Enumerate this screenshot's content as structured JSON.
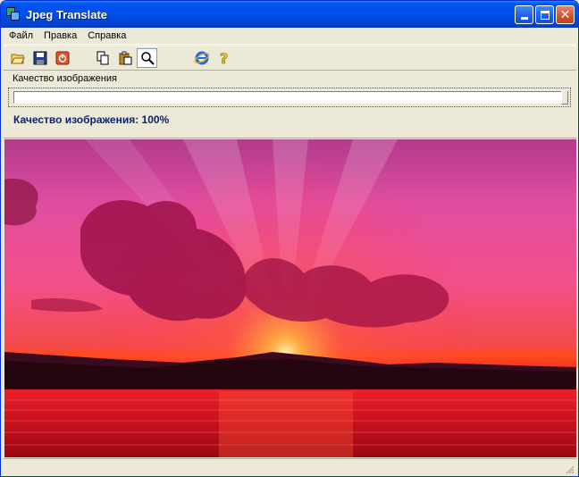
{
  "window": {
    "title": "Jpeg Translate"
  },
  "menu": {
    "items": [
      "Файл",
      "Правка",
      "Справка"
    ]
  },
  "toolbar": {
    "icons": [
      "open-folder-icon",
      "save-disk-icon",
      "exit-icon",
      "copy-icon",
      "paste-icon",
      "zoom-icon",
      "internet-explorer-icon",
      "help-icon"
    ]
  },
  "quality": {
    "label": "Качество изображения",
    "status": "Качество изображения: 100%",
    "value": 1.0
  },
  "image": {
    "subject": "sunset over sea"
  },
  "colors": {
    "titlebar": "#0053EE",
    "status_text": "#0a246a",
    "window_bg": "#ECE9D8"
  }
}
